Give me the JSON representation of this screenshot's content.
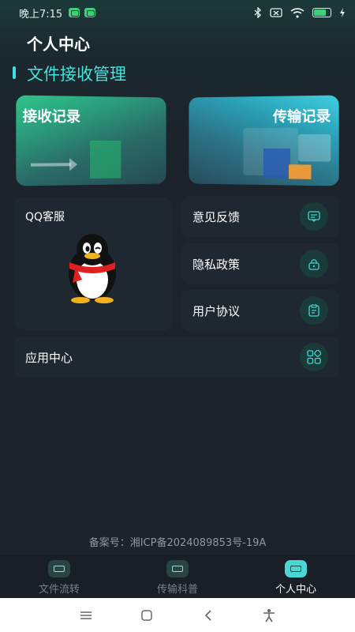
{
  "status_bar": {
    "time": "晚上7:15",
    "colors": {
      "notif": "#3bd07a",
      "battery": "#3bd07a"
    },
    "battery_level": 0.75
  },
  "header": {
    "title": "个人中心"
  },
  "section": {
    "title": "文件接收管理",
    "accent": "#43e3de"
  },
  "cards": {
    "receive": {
      "label": "接收记录"
    },
    "transfer": {
      "label": "传输记录"
    }
  },
  "qq_service": {
    "label": "QQ客服",
    "icon": "qq-penguin-icon"
  },
  "menu": [
    {
      "label": "意见反馈",
      "icon": "feedback-icon"
    },
    {
      "label": "隐私政策",
      "icon": "lock-icon"
    },
    {
      "label": "用户协议",
      "icon": "document-icon"
    }
  ],
  "app_center": {
    "label": "应用中心",
    "icon": "grid-icon"
  },
  "icp": {
    "text": "备案号：湘ICP备2024089853号-19A"
  },
  "tabbar": {
    "tabs": [
      {
        "label": "文件流转",
        "active": false
      },
      {
        "label": "传输科普",
        "active": false
      },
      {
        "label": "个人中心",
        "active": true
      }
    ]
  }
}
